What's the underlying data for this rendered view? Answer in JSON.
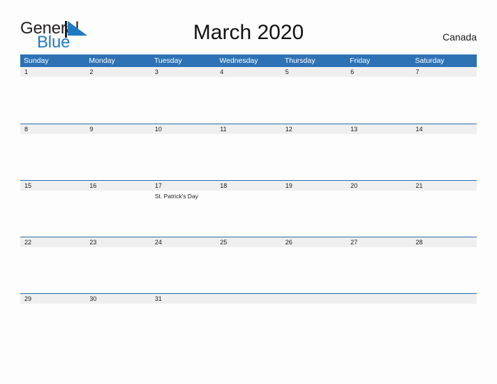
{
  "brand": {
    "name_part1": "General",
    "name_part2": "Blue",
    "mark": "triangle-logo-icon",
    "color_text": "#231f20",
    "color_accent": "#1f7ac4"
  },
  "header": {
    "title": "March 2020",
    "country": "Canada"
  },
  "calendar": {
    "header_bg": "#2d72b4",
    "date_band_bg": "#efefef",
    "row_border": "#2b6ca8",
    "weekdays": [
      "Sunday",
      "Monday",
      "Tuesday",
      "Wednesday",
      "Thursday",
      "Friday",
      "Saturday"
    ],
    "weeks": [
      {
        "days": [
          {
            "date": "1",
            "event": ""
          },
          {
            "date": "2",
            "event": ""
          },
          {
            "date": "3",
            "event": ""
          },
          {
            "date": "4",
            "event": ""
          },
          {
            "date": "5",
            "event": ""
          },
          {
            "date": "6",
            "event": ""
          },
          {
            "date": "7",
            "event": ""
          }
        ]
      },
      {
        "days": [
          {
            "date": "8",
            "event": ""
          },
          {
            "date": "9",
            "event": ""
          },
          {
            "date": "10",
            "event": ""
          },
          {
            "date": "11",
            "event": ""
          },
          {
            "date": "12",
            "event": ""
          },
          {
            "date": "13",
            "event": ""
          },
          {
            "date": "14",
            "event": ""
          }
        ]
      },
      {
        "days": [
          {
            "date": "15",
            "event": ""
          },
          {
            "date": "16",
            "event": ""
          },
          {
            "date": "17",
            "event": "St. Patrick's Day"
          },
          {
            "date": "18",
            "event": ""
          },
          {
            "date": "19",
            "event": ""
          },
          {
            "date": "20",
            "event": ""
          },
          {
            "date": "21",
            "event": ""
          }
        ]
      },
      {
        "days": [
          {
            "date": "22",
            "event": ""
          },
          {
            "date": "23",
            "event": ""
          },
          {
            "date": "24",
            "event": ""
          },
          {
            "date": "25",
            "event": ""
          },
          {
            "date": "26",
            "event": ""
          },
          {
            "date": "27",
            "event": ""
          },
          {
            "date": "28",
            "event": ""
          }
        ]
      },
      {
        "days": [
          {
            "date": "29",
            "event": ""
          },
          {
            "date": "30",
            "event": ""
          },
          {
            "date": "31",
            "event": ""
          },
          {
            "date": "",
            "event": ""
          },
          {
            "date": "",
            "event": ""
          },
          {
            "date": "",
            "event": ""
          },
          {
            "date": "",
            "event": ""
          }
        ]
      }
    ]
  }
}
